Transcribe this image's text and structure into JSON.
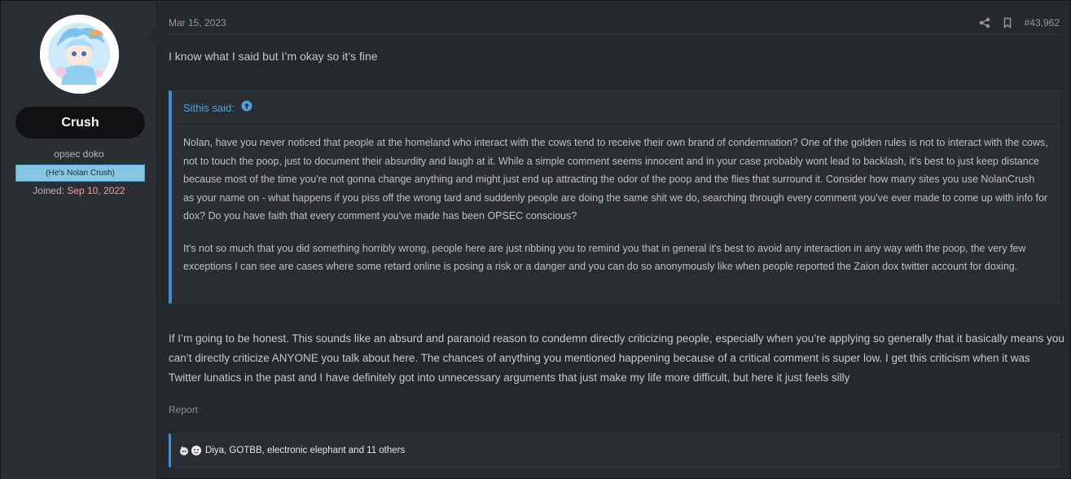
{
  "user": {
    "name": "Crush",
    "title": "opsec doko",
    "banner": "(He's Nolan Crush)",
    "joined_label": "Joined:",
    "joined_date": "Sep 10, 2022"
  },
  "post": {
    "date": "Mar 15, 2023",
    "number": "#43,962",
    "intro": "I know what I said but I’m okay so it’s fine",
    "quote": {
      "author_label": "Sithis said:",
      "paragraphs": [
        "Nolan, have you never noticed that people at the homeland who interact with the cows tend to receive their own brand of condemnation? One of the golden rules is not to interact with the cows, not to touch the poop, just to document their absurdity and laugh at it. While a simple comment seems innocent and in your case probably wont lead to backlash, it's best to just keep distance because most of the time you're not gonna change anything and might just end up attracting the odor of the poop and the flies that surround it. Consider how many sites you use NolanCrush as your name on - what happens if you piss off the wrong tard and suddenly people are doing the same shit we do, searching through every comment you've ever made to come up with info for dox? Do you have faith that every comment you've made has been OPSEC conscious?",
        "It's not so much that you did something horribly wrong, people here are just ribbing you to remind you that in general it's best to avoid any interaction in any way with the poop, the very few exceptions I can see are cases where some retard online is posing a risk or a danger and you can do so anonymously like when people reported the Zaion dox twitter account for doxing."
      ]
    },
    "reply": "If I’m going to be honest. This sounds like an absurd and paranoid reason to condemn directly criticizing people, especially when you’re applying so generally that it basically means you can’t directly criticize ANYONE you talk about here. The chances of anything you mentioned happening because of a critical comment is super low. I get this criticism when it was Twitter lunatics in the past and I have definitely got into unnecessary arguments that just make my life more difficult, but here it just feels silly",
    "report_label": "Report",
    "reactions_text": "Diya, GOTBB, electronic elephant and 11 others"
  },
  "icons": [
    "share-icon",
    "bookmark-icon",
    "arrow-up-circle-icon",
    "reaction-icon"
  ],
  "colors": {
    "accent": "#3b8fd1",
    "quote_author": "#4aa3e0",
    "banner": "#86c6e3",
    "joined_date": "#f0a0a0"
  }
}
